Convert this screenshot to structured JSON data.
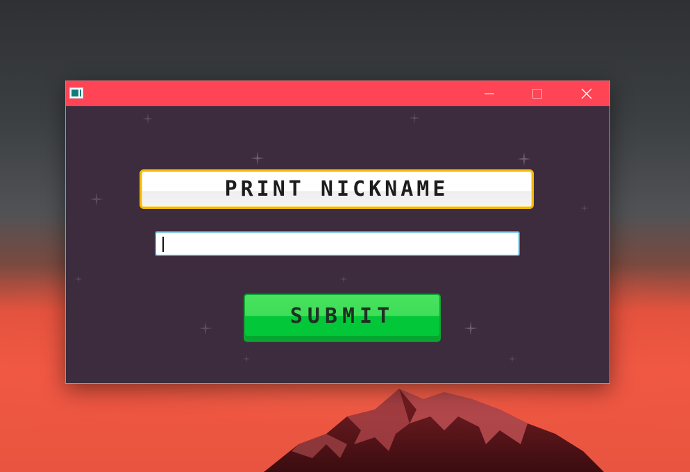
{
  "window": {
    "title_color": "#ff4455",
    "background": "#3d2b3e",
    "app_icon": "app-window-icon",
    "controls": {
      "minimize_icon": "minimize-icon",
      "maximize_icon": "maximize-icon",
      "close_icon": "close-icon"
    }
  },
  "form": {
    "heading": "PRINT NICKNAME",
    "nickname_value": "",
    "submit_label": "SUBMIT"
  },
  "colors": {
    "heading_border": "#f6b800",
    "input_border": "#27a4dd",
    "submit_green": "#02c739"
  }
}
